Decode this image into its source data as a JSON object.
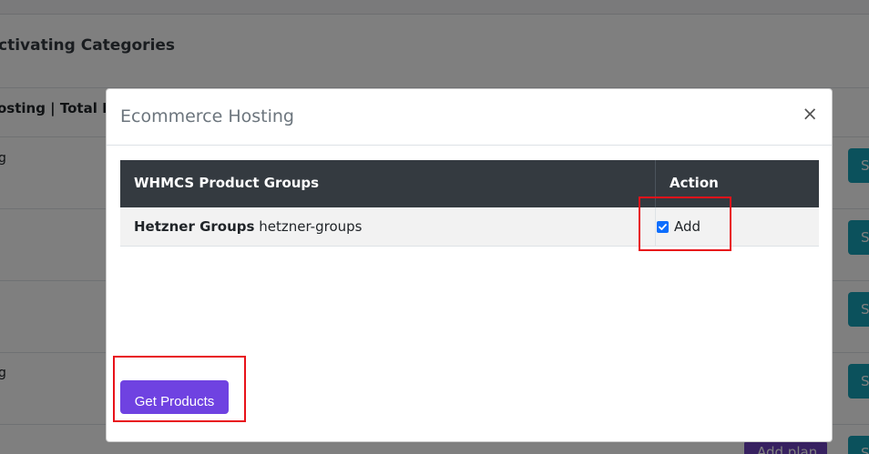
{
  "background": {
    "heading": "ctivating Categories",
    "column_header": "osting | Total Pla",
    "row_texts": [
      "g",
      "g"
    ],
    "teal_button_label": "S",
    "add_plan_label": "Add plan"
  },
  "modal": {
    "title": "Ecommerce Hosting",
    "close_label": "×",
    "table": {
      "headers": [
        "WHMCS Product Groups",
        "Action"
      ],
      "rows": [
        {
          "name_bold": "Hetzner Groups",
          "slug": "hetzner-groups",
          "action_label": "Add",
          "checked": true
        }
      ]
    },
    "primary_button": "Get Products"
  },
  "colors": {
    "overlay": "rgba(0,0,0,0.5)",
    "table_header": "#343a40",
    "primary_button": "#6f42e1",
    "checkbox": "#0d6efd",
    "highlight": "#e8121a",
    "teal": "#17a2b8"
  }
}
